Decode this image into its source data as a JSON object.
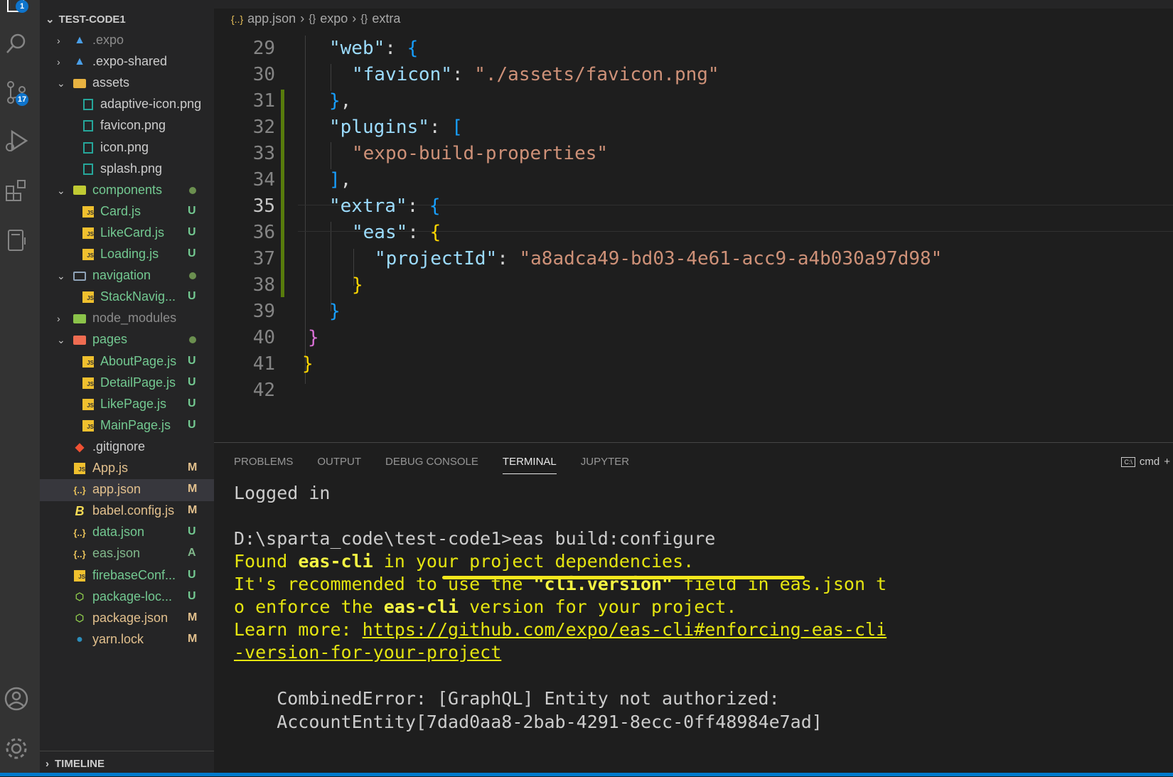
{
  "activity": {
    "explorer_badge": "1",
    "scm_badge": "17"
  },
  "explorer": {
    "header": "TEST-CODE1",
    "items": [
      {
        "name": ".expo",
        "status": ""
      },
      {
        "name": ".expo-shared",
        "status": ""
      },
      {
        "name": "assets",
        "status": ""
      },
      {
        "name": "adaptive-icon.png",
        "status": ""
      },
      {
        "name": "favicon.png",
        "status": ""
      },
      {
        "name": "icon.png",
        "status": ""
      },
      {
        "name": "splash.png",
        "status": ""
      },
      {
        "name": "components",
        "status": ""
      },
      {
        "name": "Card.js",
        "status": "U"
      },
      {
        "name": "LikeCard.js",
        "status": "U"
      },
      {
        "name": "Loading.js",
        "status": "U"
      },
      {
        "name": "navigation",
        "status": ""
      },
      {
        "name": "StackNavig...",
        "status": "U"
      },
      {
        "name": "node_modules",
        "status": ""
      },
      {
        "name": "pages",
        "status": ""
      },
      {
        "name": "AboutPage.js",
        "status": "U"
      },
      {
        "name": "DetailPage.js",
        "status": "U"
      },
      {
        "name": "LikePage.js",
        "status": "U"
      },
      {
        "name": "MainPage.js",
        "status": "U"
      },
      {
        "name": ".gitignore",
        "status": ""
      },
      {
        "name": "App.js",
        "status": "M"
      },
      {
        "name": "app.json",
        "status": "M"
      },
      {
        "name": "babel.config.js",
        "status": "M"
      },
      {
        "name": "data.json",
        "status": "U"
      },
      {
        "name": "eas.json",
        "status": "A"
      },
      {
        "name": "firebaseConf...",
        "status": "U"
      },
      {
        "name": "package-loc...",
        "status": "U"
      },
      {
        "name": "package.json",
        "status": "M"
      },
      {
        "name": "yarn.lock",
        "status": "M"
      }
    ],
    "timeline": "TIMELINE"
  },
  "editor": {
    "breadcrumb": [
      "app.json",
      "expo",
      "extra"
    ],
    "line_numbers": [
      "29",
      "30",
      "31",
      "32",
      "33",
      "34",
      "35",
      "36",
      "37",
      "38",
      "39",
      "40",
      "41",
      "42"
    ],
    "code": {
      "web_key": "\"web\"",
      "favicon_key": "\"favicon\"",
      "favicon_val": "\"./assets/favicon.png\"",
      "plugins_key": "\"plugins\"",
      "plugin_val": "\"expo-build-properties\"",
      "extra_key": "\"extra\"",
      "eas_key": "\"eas\"",
      "projectid_key": "\"projectId\"",
      "projectid_val": "\"a8adca49-bd03-4e61-acc9-a4b030a97d98\""
    }
  },
  "panel": {
    "tabs": [
      "PROBLEMS",
      "OUTPUT",
      "DEBUG CONSOLE",
      "TERMINAL",
      "JUPYTER"
    ],
    "active_tab": "TERMINAL",
    "terminal_name": "cmd",
    "terminal": {
      "logged_in": "Logged in",
      "prompt": "D:\\sparta_code\\test-code1>eas build:configure",
      "found_1": "Found ",
      "found_b": "eas-cli",
      "found_2": " in your project dependencies.",
      "rec_1": "It's recommended to use the ",
      "rec_b": "\"cli.version\"",
      "rec_2": " field in eas.json t",
      "enf_1": "o enforce the ",
      "enf_b": "eas-cli",
      "enf_2": " version for your project.",
      "learn": "Learn more: ",
      "link_1": "https://github.com/expo/eas-cli#enforcing-eas-cli",
      "link_2": "-version-for-your-project",
      "err_1": "    CombinedError: [GraphQL] Entity not authorized:",
      "err_2": "    AccountEntity[7dad0aa8-2bab-4291-8ecc-0ff48984e7ad]"
    }
  },
  "colors": {
    "status_bar": "#007acc",
    "highlight_underline": "#f5e71c"
  }
}
